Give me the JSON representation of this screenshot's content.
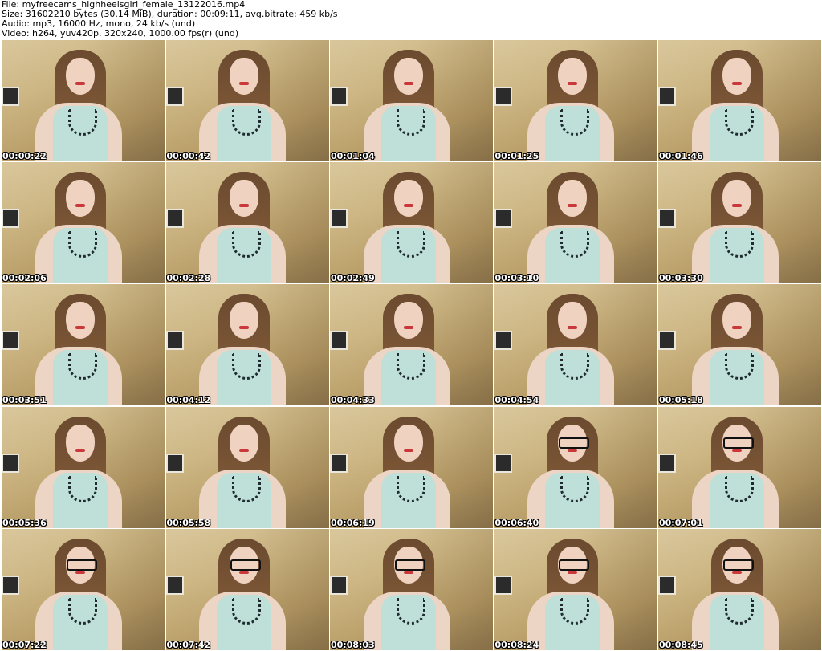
{
  "header": {
    "file": "File: myfreecams_highheelsgirl_female_13122016.mp4",
    "size": "Size: 31602210 bytes (30.14 MiB), duration: 00:09:11, avg.bitrate: 459 kb/s",
    "audio": "Audio: mp3, 16000 Hz, mono, 24 kb/s (und)",
    "video": "Video: h264, yuv420p, 320x240, 1000.00 fps(r) (und)"
  },
  "thumbnails": [
    {
      "timestamp": "00:00:22",
      "glasses": false
    },
    {
      "timestamp": "00:00:42",
      "glasses": false
    },
    {
      "timestamp": "00:01:04",
      "glasses": false
    },
    {
      "timestamp": "00:01:25",
      "glasses": false
    },
    {
      "timestamp": "00:01:46",
      "glasses": false
    },
    {
      "timestamp": "00:02:06",
      "glasses": false
    },
    {
      "timestamp": "00:02:28",
      "glasses": false
    },
    {
      "timestamp": "00:02:49",
      "glasses": false
    },
    {
      "timestamp": "00:03:10",
      "glasses": false
    },
    {
      "timestamp": "00:03:30",
      "glasses": false
    },
    {
      "timestamp": "00:03:51",
      "glasses": false
    },
    {
      "timestamp": "00:04:12",
      "glasses": false
    },
    {
      "timestamp": "00:04:33",
      "glasses": false
    },
    {
      "timestamp": "00:04:54",
      "glasses": false
    },
    {
      "timestamp": "00:05:18",
      "glasses": false
    },
    {
      "timestamp": "00:05:36",
      "glasses": false
    },
    {
      "timestamp": "00:05:58",
      "glasses": false
    },
    {
      "timestamp": "00:06:19",
      "glasses": false
    },
    {
      "timestamp": "00:06:40",
      "glasses": true
    },
    {
      "timestamp": "00:07:01",
      "glasses": true
    },
    {
      "timestamp": "00:07:22",
      "glasses": true
    },
    {
      "timestamp": "00:07:42",
      "glasses": true
    },
    {
      "timestamp": "00:08:03",
      "glasses": true
    },
    {
      "timestamp": "00:08:24",
      "glasses": true
    },
    {
      "timestamp": "00:08:45",
      "glasses": true
    }
  ]
}
